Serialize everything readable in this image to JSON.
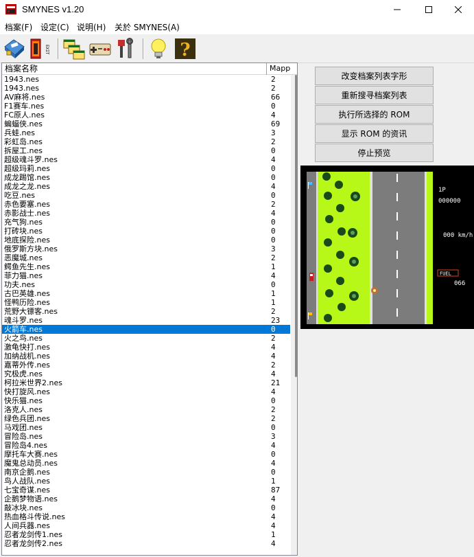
{
  "window": {
    "title": "SMYNES v1.20"
  },
  "menu": [
    "档案(F)",
    "设定(C)",
    "说明(H)",
    "关於 SMYNES(A)"
  ],
  "toolbar": {
    "icons": [
      "rom-info-icon",
      "exit-icon",
      "windows-icon",
      "gamepad-icon",
      "tools-icon",
      "lightbulb-icon",
      "help-icon"
    ],
    "exit_label": "EXIT"
  },
  "list": {
    "col_name": "档案名称",
    "col_mapper": "Mapper",
    "rows": [
      [
        "1943.nes",
        "2"
      ],
      [
        "1943.nes",
        "2"
      ],
      [
        "AV麻将.nes",
        "66"
      ],
      [
        "F1赛车.nes",
        "0"
      ],
      [
        "FC原人.nes",
        "4"
      ],
      [
        "蝙蝠侠.nes",
        "69"
      ],
      [
        "兵蛙.nes",
        "3"
      ],
      [
        "彩虹岛.nes",
        "2"
      ],
      [
        "拆屋工.nes",
        "0"
      ],
      [
        "超级魂斗罗.nes",
        "4"
      ],
      [
        "超级玛莉.nes",
        "0"
      ],
      [
        "成龙踢馆.nes",
        "0"
      ],
      [
        "成龙之龙.nes",
        "4"
      ],
      [
        "吃豆.nes",
        "0"
      ],
      [
        "赤色要塞.nes",
        "2"
      ],
      [
        "赤影战士.nes",
        "4"
      ],
      [
        "充气狗.nes",
        "0"
      ],
      [
        "打砖块.nes",
        "0"
      ],
      [
        "地底探险.nes",
        "0"
      ],
      [
        "俄罗斯方块.nes",
        "3"
      ],
      [
        "恶魔城.nes",
        "2"
      ],
      [
        "鳄鱼先生.nes",
        "1"
      ],
      [
        "菲力猫.nes",
        "4"
      ],
      [
        "功夫.nes",
        "0"
      ],
      [
        "古巴英雄.nes",
        "1"
      ],
      [
        "怪鸭历险.nes",
        "1"
      ],
      [
        "荒野大镖客.nes",
        "2"
      ],
      [
        "魂斗罗.nes",
        "23"
      ],
      [
        "火箭车.nes",
        "0"
      ],
      [
        "火之鸟.nes",
        "2"
      ],
      [
        "激龟快打.nes",
        "4"
      ],
      [
        "加纳战机.nes",
        "4"
      ],
      [
        "嘉蒂外传.nes",
        "2"
      ],
      [
        "究极虎.nes",
        "4"
      ],
      [
        "柯拉米世界2.nes",
        "21"
      ],
      [
        "快打旋风.nes",
        "4"
      ],
      [
        "快乐猫.nes",
        "0"
      ],
      [
        "洛克人.nes",
        "2"
      ],
      [
        "绿色兵团.nes",
        "2"
      ],
      [
        "马戏团.nes",
        "0"
      ],
      [
        "冒险岛.nes",
        "3"
      ],
      [
        "冒险岛4.nes",
        "4"
      ],
      [
        "摩托车大赛.nes",
        "0"
      ],
      [
        "魔鬼总动员.nes",
        "4"
      ],
      [
        "南京企鹅.nes",
        "0"
      ],
      [
        "鸟人战队.nes",
        "1"
      ],
      [
        "七宝奇谋.nes",
        "87"
      ],
      [
        "企鹅梦物语.nes",
        "4"
      ],
      [
        "敲冰块.nes",
        "0"
      ],
      [
        "热血格斗传说.nes",
        "4"
      ],
      [
        "人间兵器.nes",
        "4"
      ],
      [
        "忍者龙剑传1.nes",
        "1"
      ],
      [
        "忍者龙剑传2.nes",
        "4"
      ]
    ],
    "selected_index": 28
  },
  "actions": [
    "改变档案列表字形",
    "重新搜寻档案列表",
    "执行所选择的 ROM",
    "显示 ROM 的资讯",
    "停止预览"
  ],
  "preview": {
    "player": "1P",
    "score": "000000",
    "speed": "000 km/h",
    "fuel_label": "FUEL",
    "fuel": "066"
  },
  "colors": {
    "selection": "#0078d7",
    "grass": "#b8f818",
    "road": "#7c7c7c"
  }
}
